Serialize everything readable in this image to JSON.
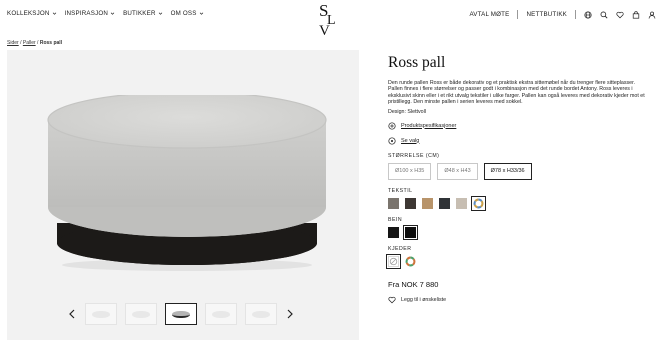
{
  "header": {
    "nav_left": [
      {
        "label": "KOLLEKSJON"
      },
      {
        "label": "INSPIRASJON"
      },
      {
        "label": "BUTIKKER"
      },
      {
        "label": "OM OSS"
      }
    ],
    "logo": "SLV",
    "nav_right": {
      "appointment": "AVTAL MØTE",
      "webshop": "NETTBUTIKK"
    },
    "icons": [
      "globe-icon",
      "search-icon",
      "heart-icon",
      "bag-icon",
      "user-icon"
    ]
  },
  "breadcrumb": {
    "items": [
      "Sider",
      "Paller"
    ],
    "separator": "/",
    "current": "Ross pall"
  },
  "gallery": {
    "thumbnail_count": 5,
    "active_thumbnail": 3
  },
  "product": {
    "title": "Ross pall",
    "description": "Den runde pallen Ross er både dekorativ og et praktisk ekstra sittemøbel når du trenger flere sitteplasser. Pallen finnes i flere størrelser og passer godt i kombinasjon med det runde bordet Antony. Ross leveres i eksklusivt skinn eller i et rikt utvalg tekstiler i ulike farger. Pallen kan også leveres med dekorativ kjeder mot et pristillegg. Den minste pallen i serien leveres med sokkel.",
    "design": "Design: Slettvoll",
    "spec_link": "Produktspesifikasjoner",
    "view_link": "Se valg",
    "size_label": "STØRRELSE (CM)",
    "sizes": [
      {
        "label": "Ø100 x H35",
        "selected": false
      },
      {
        "label": "Ø48 x H43",
        "selected": false
      },
      {
        "label": "Ø78 x H33/36",
        "selected": true
      }
    ],
    "textile_label": "TEKSTIL",
    "textiles": [
      {
        "color": "#7a746d",
        "selected": false
      },
      {
        "color": "#3d3733",
        "selected": false
      },
      {
        "color": "#b8946a",
        "selected": false
      },
      {
        "color": "#2f3236",
        "selected": false
      },
      {
        "color": "#c7beb2",
        "selected": false
      },
      {
        "color": "multi",
        "selected": true
      }
    ],
    "leg_label": "BEIN",
    "legs": [
      {
        "color": "#151515",
        "selected": false
      },
      {
        "color": "#0d0d0d",
        "selected": true
      }
    ],
    "chain_label": "KJEDER",
    "chains": [
      {
        "color": "none",
        "selected": true
      },
      {
        "color": "multi",
        "selected": false
      }
    ],
    "price": "Fra NOK 7 880",
    "wishlist": "Legg til i ønskeliste"
  },
  "colors": {
    "ottoman_fabric": "#d6d6d4",
    "ottoman_base": "#1c1a18",
    "image_bg": "#f2f2f2"
  }
}
